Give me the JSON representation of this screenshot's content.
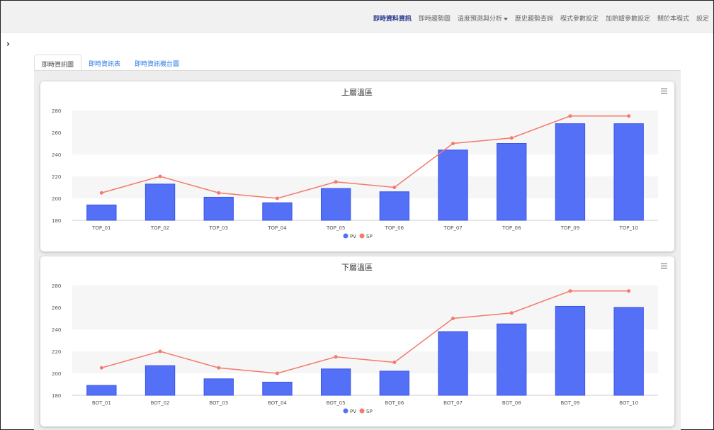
{
  "nav": {
    "items": [
      {
        "label": "即時資料資訊",
        "active": true
      },
      {
        "label": "即時趨勢圖"
      },
      {
        "label": "溫度預測與分析",
        "dropdown": true
      },
      {
        "label": "歷史趨勢查詢"
      },
      {
        "label": "程式參數設定"
      },
      {
        "label": "加熱爐參數設定"
      },
      {
        "label": "關於本程式"
      },
      {
        "label": "設定"
      }
    ]
  },
  "sidebar_toggle_icon": "chevron-right-icon",
  "tabs": [
    {
      "label": "即時資訊圖",
      "active": true
    },
    {
      "label": "即時資訊表"
    },
    {
      "label": "即時資訊機台圖"
    }
  ],
  "colors": {
    "bar": "#5470f6",
    "line": "#f47a6c",
    "accent_nav": "#2a3b8f",
    "tab_link": "#2c7be5"
  },
  "chart_data": [
    {
      "type": "bar",
      "title": "上層溫區",
      "categories": [
        "TOP_01",
        "TOP_02",
        "TOP_03",
        "TOP_04",
        "TOP_05",
        "TOP_06",
        "TOP_07",
        "TOP_08",
        "TOP_09",
        "TOP_10"
      ],
      "series": [
        {
          "name": "PV",
          "type": "bar",
          "values": [
            194,
            213,
            201,
            196,
            209,
            206,
            244,
            250,
            268,
            268
          ]
        },
        {
          "name": "SP",
          "type": "line",
          "values": [
            205,
            220,
            205,
            200,
            215,
            210,
            250,
            255,
            275,
            275
          ]
        }
      ],
      "ylim": [
        180,
        280
      ],
      "yticks": [
        180,
        200,
        220,
        240,
        260,
        280
      ],
      "legend": "bottom-center"
    },
    {
      "type": "bar",
      "title": "下層溫區",
      "categories": [
        "BOT_01",
        "BOT_02",
        "BOT_03",
        "BOT_04",
        "BOT_05",
        "BOT_06",
        "BOT_07",
        "BOT_08",
        "BOT_09",
        "BOT_10"
      ],
      "series": [
        {
          "name": "PV",
          "type": "bar",
          "values": [
            189,
            207,
            195,
            192,
            204,
            202,
            238,
            245,
            261,
            260
          ]
        },
        {
          "name": "SP",
          "type": "line",
          "values": [
            205,
            220,
            205,
            200,
            215,
            210,
            250,
            255,
            275,
            275
          ]
        }
      ],
      "ylim": [
        180,
        280
      ],
      "yticks": [
        180,
        200,
        220,
        240,
        260,
        280
      ],
      "legend": "bottom-center"
    }
  ]
}
